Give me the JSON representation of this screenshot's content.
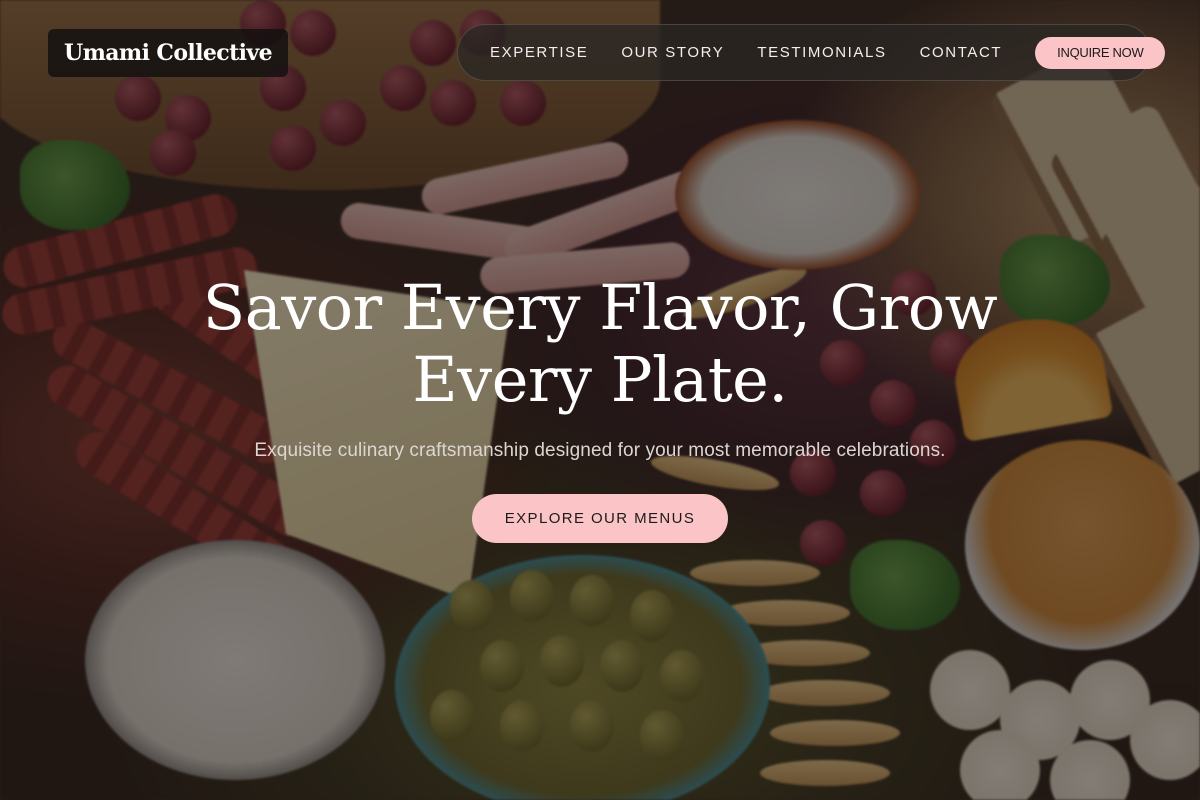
{
  "header": {
    "brand": "Umami Collective",
    "nav": [
      {
        "label": "EXPERTISE"
      },
      {
        "label": "OUR STORY"
      },
      {
        "label": "TESTIMONIALS"
      },
      {
        "label": "CONTACT"
      }
    ],
    "inquire_label": "INQUIRE NOW"
  },
  "hero": {
    "title_line1": "Savor Every Flavor, Grow",
    "title_line2": "Every Plate.",
    "subtitle": "Exquisite culinary craftsmanship designed for your most memorable celebrations.",
    "cta_label": "EXPLORE OUR MENUS"
  },
  "colors": {
    "accent_pink": "#fbc5c8",
    "nav_bg": "#2a2624",
    "brand_bg": "#121010"
  },
  "background_image": "charcuterie-grazing-board-photo"
}
